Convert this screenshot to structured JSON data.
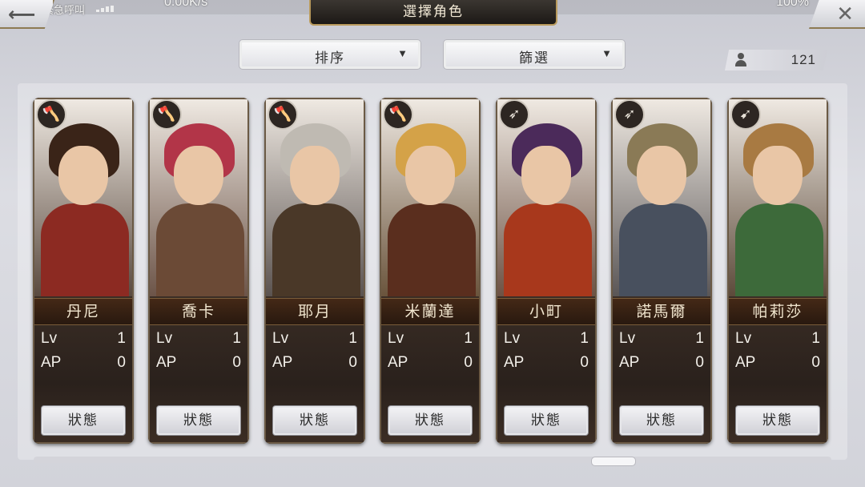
{
  "statusbar": {
    "left_text": "僅限緊急呼叫",
    "speed": "0.00K/s",
    "right_text": "100%"
  },
  "header": {
    "title": "選擇角色",
    "back_icon": "back-arrow-icon",
    "close_icon": "close-icon"
  },
  "controls": {
    "sort_label": "排序",
    "filter_label": "篩選",
    "count": "121"
  },
  "cards": [
    {
      "name": "丹尼",
      "lv_label": "Lv",
      "lv": "1",
      "ap_label": "AP",
      "ap": "0",
      "status_label": "狀態",
      "weapon_icon": "axe-icon",
      "palette": {
        "bg": "#5a4a3f",
        "hair": "#3a2418",
        "body": "#8c2a22"
      }
    },
    {
      "name": "喬卡",
      "lv_label": "Lv",
      "lv": "1",
      "ap_label": "AP",
      "ap": "0",
      "status_label": "狀態",
      "weapon_icon": "axe-icon",
      "palette": {
        "bg": "#6c5448",
        "hair": "#b23548",
        "body": "#6b4a36"
      }
    },
    {
      "name": "耶月",
      "lv_label": "Lv",
      "lv": "1",
      "ap_label": "AP",
      "ap": "0",
      "status_label": "狀態",
      "weapon_icon": "axe-icon",
      "palette": {
        "bg": "#5b5350",
        "hair": "#bfbab2",
        "body": "#4a3828"
      }
    },
    {
      "name": "米蘭達",
      "lv_label": "Lv",
      "lv": "1",
      "ap_label": "AP",
      "ap": "0",
      "status_label": "狀態",
      "weapon_icon": "axe-icon",
      "palette": {
        "bg": "#6a543c",
        "hair": "#d4a248",
        "body": "#5a2e1e"
      }
    },
    {
      "name": "小町",
      "lv_label": "Lv",
      "lv": "1",
      "ap_label": "AP",
      "ap": "0",
      "status_label": "狀態",
      "weapon_icon": "spear-icon",
      "palette": {
        "bg": "#6d5244",
        "hair": "#4b2a5a",
        "body": "#a8381c"
      }
    },
    {
      "name": "諾馬爾",
      "lv_label": "Lv",
      "lv": "1",
      "ap_label": "AP",
      "ap": "0",
      "status_label": "狀態",
      "weapon_icon": "spear-icon",
      "palette": {
        "bg": "#5a5656",
        "hair": "#8a7a56",
        "body": "#48505e"
      }
    },
    {
      "name": "帕莉莎",
      "lv_label": "Lv",
      "lv": "1",
      "ap_label": "AP",
      "ap": "0",
      "status_label": "狀態",
      "weapon_icon": "bow-icon",
      "palette": {
        "bg": "#5c4a3a",
        "hair": "#a87a42",
        "body": "#3d6a3a"
      }
    }
  ]
}
